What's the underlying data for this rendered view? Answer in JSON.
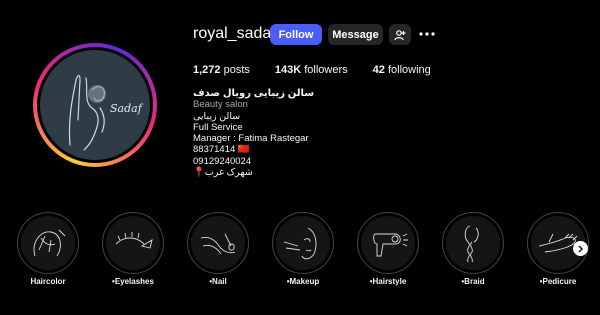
{
  "profile": {
    "username": "royal_sadaf",
    "follow_label": "Follow",
    "message_label": "Message",
    "avatar_text": "Sadaf"
  },
  "stats": {
    "posts_count": "1,272",
    "posts_label": "posts",
    "followers_count": "143K",
    "followers_label": "followers",
    "following_count": "42",
    "following_label": "following"
  },
  "bio": {
    "name": "سالن زیبایی رویال صدف",
    "category": "Beauty salon",
    "lines": [
      "سالن زیبایی",
      "Full Service",
      "Manager : Fatima Rastegar",
      "88371414 🇨🇳",
      "09129240024",
      "📍شهرک غرب"
    ]
  },
  "highlights": [
    {
      "label": "Haircolor",
      "icon": "hair-sketch-icon"
    },
    {
      "label": "•Eyelashes",
      "icon": "eyelash-sketch-icon"
    },
    {
      "label": "•Nail",
      "icon": "nail-sketch-icon"
    },
    {
      "label": "•Makeup",
      "icon": "makeup-sketch-icon"
    },
    {
      "label": "•Hairstyle",
      "icon": "hairdryer-sketch-icon"
    },
    {
      "label": "•Braid",
      "icon": "braid-sketch-icon"
    },
    {
      "label": "•Pedicure",
      "icon": "foot-sketch-icon"
    }
  ],
  "colors": {
    "background": "#000000",
    "follow_button": "#4a5df9",
    "secondary_button": "#262626"
  }
}
